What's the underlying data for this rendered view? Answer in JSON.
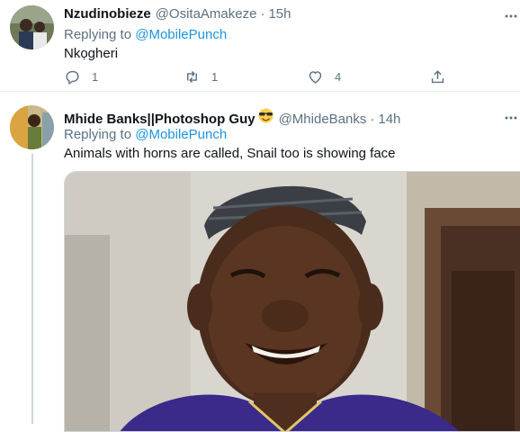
{
  "tweets": [
    {
      "display_name": "Nzudinobieze",
      "handle": "@OsitaAmakeze",
      "separator": "·",
      "time": "15h",
      "replying_prefix": "Replying to",
      "replying_to": "@MobilePunch",
      "text": "Nkọgheri",
      "actions": {
        "replies": "1",
        "retweets": "1",
        "likes": "4"
      }
    },
    {
      "display_name": "Mhide Banks||Photoshop Guy",
      "name_emoji": "sunglasses-face-emoji",
      "handle": "@MhideBanks",
      "separator": "·",
      "time": "14h",
      "replying_prefix": "Replying to",
      "replying_to": "@MobilePunch",
      "text": "Animals with horns are called, Snail too is showing face"
    }
  ],
  "icons": {
    "reply": "speech-bubble-icon",
    "retweet": "retweet-arrows-icon",
    "like": "heart-icon",
    "share": "share-upload-icon",
    "more": "ellipsis-icon"
  },
  "colors": {
    "link": "#1b95e0",
    "secondary_text": "#5b7083",
    "divider": "#e6ecf0"
  }
}
